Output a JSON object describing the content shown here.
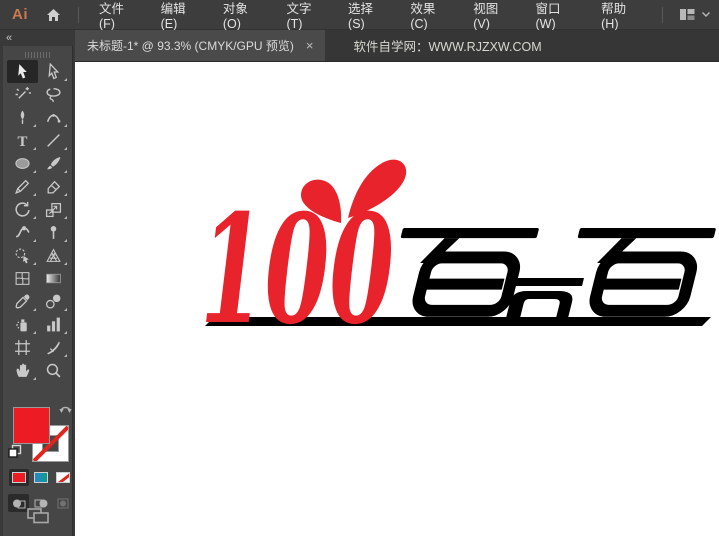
{
  "app": {
    "logo_text": "Ai",
    "accent": "#c97b4f"
  },
  "menubar": {
    "items": [
      "文件(F)",
      "编辑(E)",
      "对象(O)",
      "文字(T)",
      "选择(S)",
      "效果(C)",
      "视图(V)",
      "窗口(W)",
      "帮助(H)"
    ]
  },
  "tabbar": {
    "document_tab": {
      "title": "未标题-1* @ 93.3% (CMYK/GPU 预览)",
      "close_glyph": "×"
    },
    "site_label": "软件自学网：WWW.RJZXW.COM"
  },
  "toolbar": {
    "collapse_glyph": "«",
    "tools": [
      {
        "name": "selection",
        "active": true,
        "flyout": false
      },
      {
        "name": "direct-selection",
        "active": false,
        "flyout": true
      },
      {
        "name": "magic-wand",
        "active": false,
        "flyout": false
      },
      {
        "name": "lasso",
        "active": false,
        "flyout": false
      },
      {
        "name": "pen",
        "active": false,
        "flyout": true
      },
      {
        "name": "curvature",
        "active": false,
        "flyout": true
      },
      {
        "name": "type",
        "active": false,
        "flyout": true
      },
      {
        "name": "line-segment",
        "active": false,
        "flyout": true
      },
      {
        "name": "ellipse",
        "active": false,
        "flyout": true
      },
      {
        "name": "paintbrush",
        "active": false,
        "flyout": true
      },
      {
        "name": "pencil",
        "active": false,
        "flyout": true
      },
      {
        "name": "eraser",
        "active": false,
        "flyout": true
      },
      {
        "name": "rotate",
        "active": false,
        "flyout": true
      },
      {
        "name": "scale",
        "active": false,
        "flyout": true
      },
      {
        "name": "width",
        "active": false,
        "flyout": true
      },
      {
        "name": "puppet-warp",
        "active": false,
        "flyout": true
      },
      {
        "name": "shape-builder",
        "active": false,
        "flyout": true
      },
      {
        "name": "perspective-grid",
        "active": false,
        "flyout": true
      },
      {
        "name": "mesh",
        "active": false,
        "flyout": false
      },
      {
        "name": "gradient",
        "active": false,
        "flyout": false
      },
      {
        "name": "eyedropper",
        "active": false,
        "flyout": true
      },
      {
        "name": "blend",
        "active": false,
        "flyout": true
      },
      {
        "name": "symbol-sprayer",
        "active": false,
        "flyout": true
      },
      {
        "name": "column-graph",
        "active": false,
        "flyout": true
      },
      {
        "name": "artboard",
        "active": false,
        "flyout": false
      },
      {
        "name": "slice",
        "active": false,
        "flyout": true
      },
      {
        "name": "hand",
        "active": false,
        "flyout": true
      },
      {
        "name": "zoom",
        "active": false,
        "flyout": false
      }
    ],
    "fill_color": "#ed1c24",
    "stroke_style": "none",
    "swatch_buttons": [
      "color",
      "gradient",
      "none"
    ],
    "gradient_colors": [
      "#2b86c8",
      "#0f9b8e"
    ],
    "drawing_modes": [
      "draw-normal",
      "draw-behind",
      "draw-inside"
    ],
    "active_drawing_mode": "draw-normal"
  },
  "canvas": {
    "logo": {
      "number": "100",
      "characters": "百分百",
      "full_text": "100百分百",
      "red": "#e8232b",
      "black": "#000000"
    }
  },
  "ui_colors": {
    "chrome_bg": "#3d3d3d",
    "panel_bg": "#464646",
    "tab_active_bg": "#4a4a4a",
    "canvas_bg": "#ffffff"
  }
}
